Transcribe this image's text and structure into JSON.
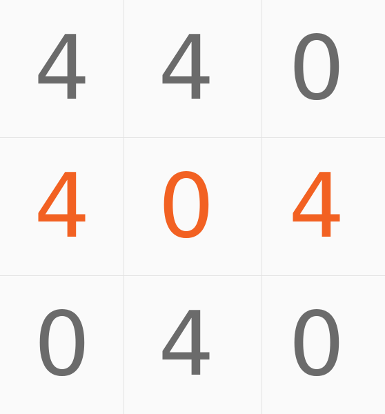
{
  "grid": {
    "rows": [
      {
        "cells": [
          {
            "digit": "4",
            "highlighted": false
          },
          {
            "digit": "4",
            "highlighted": false
          },
          {
            "digit": "0",
            "highlighted": false
          }
        ]
      },
      {
        "cells": [
          {
            "digit": "4",
            "highlighted": true
          },
          {
            "digit": "0",
            "highlighted": true
          },
          {
            "digit": "4",
            "highlighted": true
          }
        ]
      },
      {
        "cells": [
          {
            "digit": "0",
            "highlighted": false
          },
          {
            "digit": "4",
            "highlighted": false
          },
          {
            "digit": "0",
            "highlighted": false
          }
        ]
      }
    ]
  },
  "colors": {
    "background": "#fafafa",
    "digit": "#6b6b6b",
    "accent": "#f26122",
    "gridline": "#e3e3e3"
  }
}
